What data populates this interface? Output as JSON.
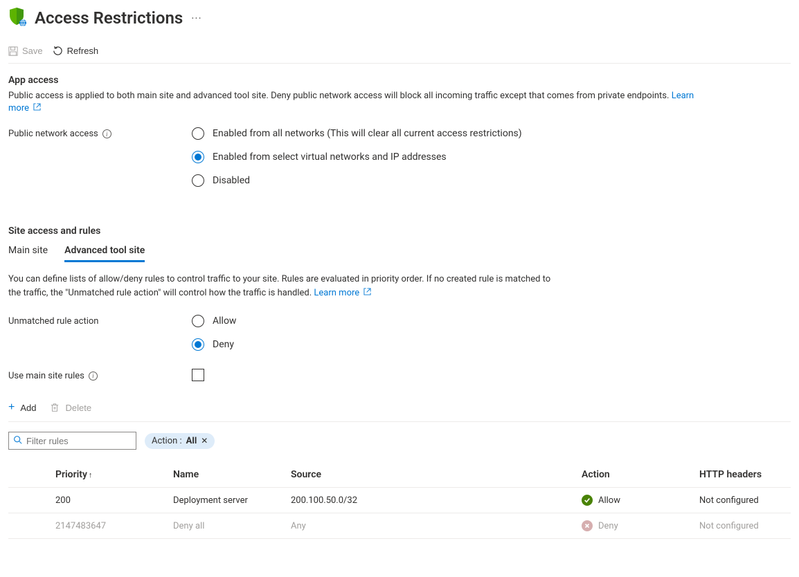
{
  "header": {
    "title": "Access Restrictions"
  },
  "toolbar": {
    "save": "Save",
    "refresh": "Refresh"
  },
  "app_access": {
    "title": "App access",
    "desc": "Public access is applied to both main site and advanced tool site. Deny public network access will block all incoming traffic except that comes from private endpoints.",
    "learn_more": "Learn more",
    "public_label": "Public network access",
    "options": {
      "all": "Enabled from all networks (This will clear all current access restrictions)",
      "select": "Enabled from select virtual networks and IP addresses",
      "disabled": "Disabled"
    }
  },
  "site_access": {
    "title": "Site access and rules",
    "tabs": {
      "main": "Main site",
      "advanced": "Advanced tool site"
    },
    "desc": "You can define lists of allow/deny rules to control traffic to your site. Rules are evaluated in priority order. If no created rule is matched to the traffic, the \"Unmatched rule action\" will control how the traffic is handled.",
    "learn_more": "Learn more",
    "unmatched_label": "Unmatched rule action",
    "unmatched_options": {
      "allow": "Allow",
      "deny": "Deny"
    },
    "use_main_label": "Use main site rules"
  },
  "rules_toolbar": {
    "add": "Add",
    "delete": "Delete"
  },
  "filter": {
    "placeholder": "Filter rules",
    "pill_prefix": "Action : ",
    "pill_value": "All"
  },
  "table": {
    "headers": {
      "priority": "Priority",
      "name": "Name",
      "source": "Source",
      "action": "Action",
      "http": "HTTP headers"
    },
    "rows": [
      {
        "priority": "200",
        "name": "Deployment server",
        "source": "200.100.50.0/32",
        "action": "Allow",
        "action_type": "allow",
        "http": "Not configured",
        "dim": false
      },
      {
        "priority": "2147483647",
        "name": "Deny all",
        "source": "Any",
        "action": "Deny",
        "action_type": "deny",
        "http": "Not configured",
        "dim": true
      }
    ]
  }
}
